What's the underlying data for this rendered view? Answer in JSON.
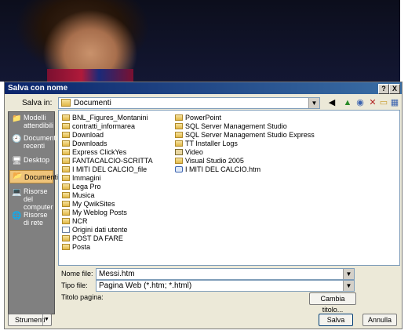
{
  "dialog": {
    "title": "Salva con nome",
    "help_label": "?",
    "close_label": "X",
    "save_in_label": "Salva in:",
    "current_folder": "Documenti"
  },
  "places": [
    {
      "label": "Modelli attendibili",
      "icon": "folder-icon"
    },
    {
      "label": "Documenti recenti",
      "icon": "recent-documents-icon"
    },
    {
      "label": "Desktop",
      "icon": "desktop-icon"
    },
    {
      "label": "Documenti",
      "icon": "documents-folder-icon",
      "selected": true
    },
    {
      "label": "Risorse del computer",
      "icon": "computer-icon"
    },
    {
      "label": "Risorse di rete",
      "icon": "network-icon"
    }
  ],
  "files_col1": [
    {
      "name": "BNL_Figures_Montanini",
      "icon": "folder"
    },
    {
      "name": "contratti_informarea",
      "icon": "folder"
    },
    {
      "name": "Download",
      "icon": "folder"
    },
    {
      "name": "Downloads",
      "icon": "folder"
    },
    {
      "name": "Express ClickYes",
      "icon": "folder"
    },
    {
      "name": "FANTACALCIO-SCRITTA",
      "icon": "folder"
    },
    {
      "name": "I MITI DEL CALCIO_file",
      "icon": "folder"
    },
    {
      "name": "Immagini",
      "icon": "folder"
    },
    {
      "name": "Lega Pro",
      "icon": "folder"
    },
    {
      "name": "Musica",
      "icon": "folder"
    },
    {
      "name": "My QwikSites",
      "icon": "folder"
    },
    {
      "name": "My Weblog Posts",
      "icon": "folder"
    },
    {
      "name": "NCR",
      "icon": "folder"
    },
    {
      "name": "Origini dati utente",
      "icon": "doc"
    },
    {
      "name": "POST DA FARE",
      "icon": "folder"
    },
    {
      "name": "Posta",
      "icon": "folder"
    }
  ],
  "files_col2": [
    {
      "name": "PowerPoint",
      "icon": "folder"
    },
    {
      "name": "SQL Server Management Studio",
      "icon": "folder"
    },
    {
      "name": "SQL Server Management Studio Express",
      "icon": "folder"
    },
    {
      "name": "TT Installer Logs",
      "icon": "folder"
    },
    {
      "name": "Video",
      "icon": "video"
    },
    {
      "name": "Visual Studio 2005",
      "icon": "folder"
    },
    {
      "name": "I MITI DEL CALCIO.htm",
      "icon": "web"
    }
  ],
  "form": {
    "filename_label": "Nome file:",
    "filename_value": "Messi.htm",
    "filetype_label": "Tipo file:",
    "filetype_value": "Pagina Web (*.htm; *.html)",
    "pagetitle_label": "Titolo pagina:",
    "change_title_button": "Cambia titolo..."
  },
  "footer": {
    "tools_button": "Strumenti",
    "save_button": "Salva",
    "cancel_button": "Annulla"
  }
}
